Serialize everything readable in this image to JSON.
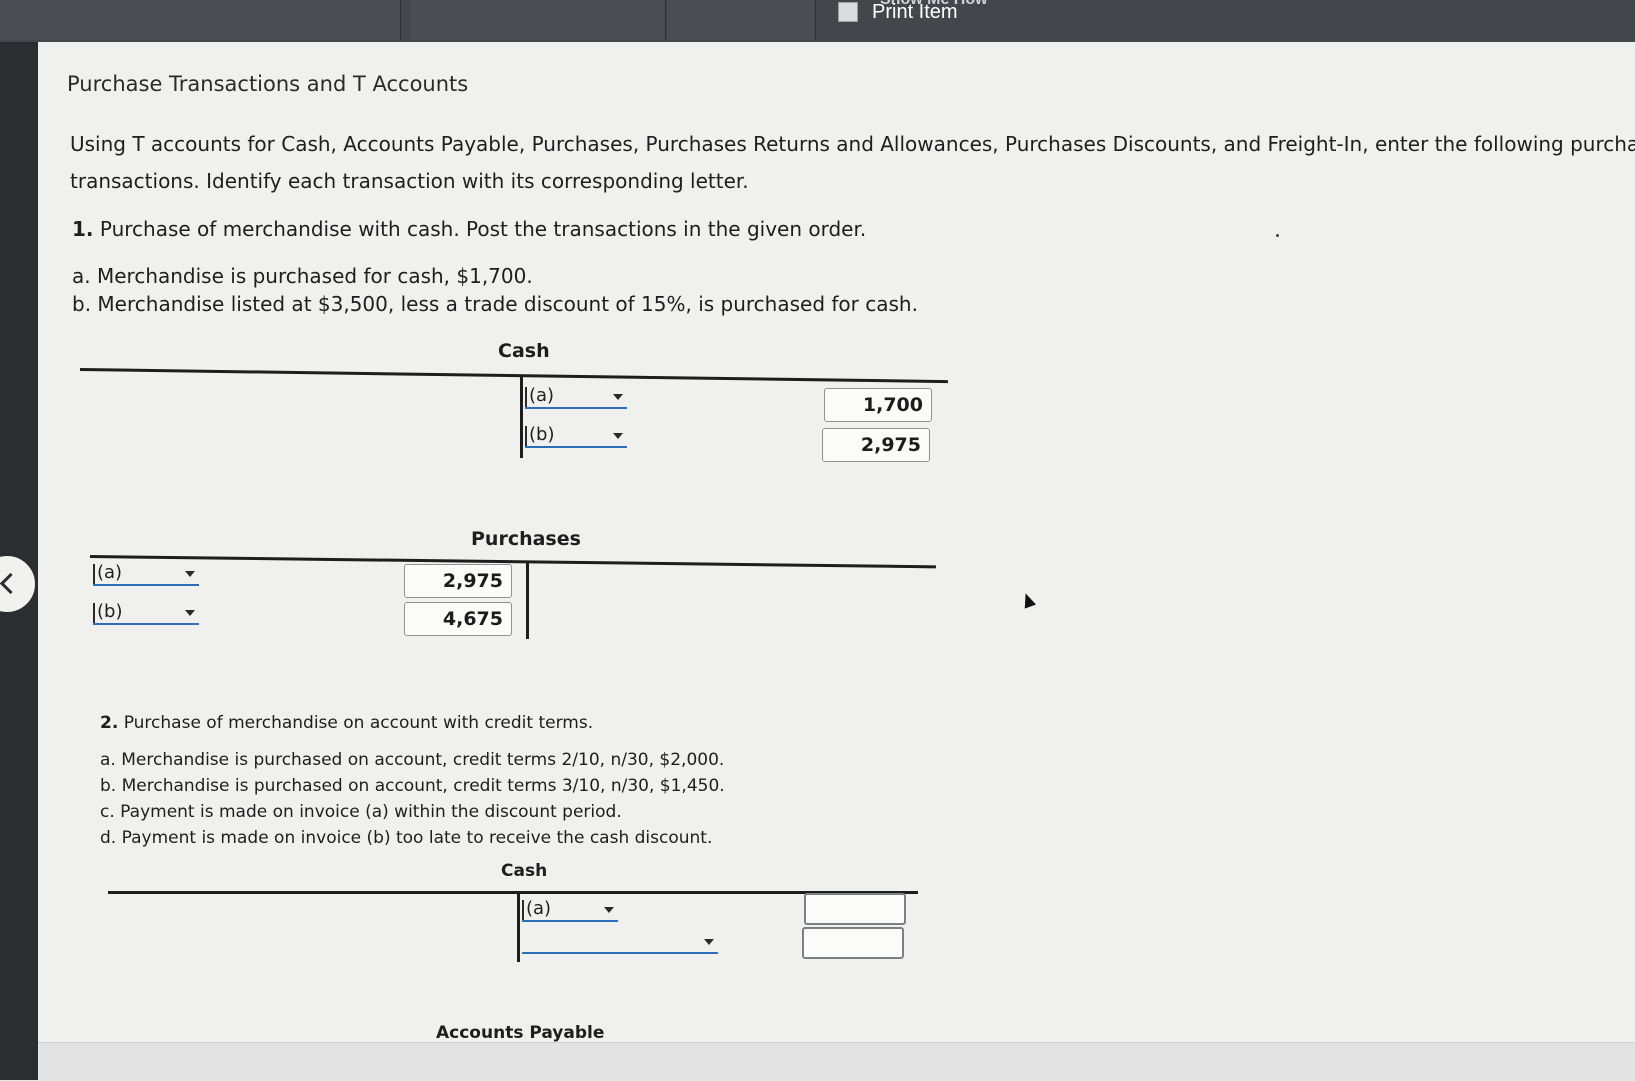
{
  "toolbar": {
    "show_me_how_label": "Show Me How",
    "print_label": "Print Item"
  },
  "page": {
    "title": "Purchase Transactions and T Accounts",
    "intro_line1": "Using T accounts for Cash, Accounts Payable, Purchases, Purchases Returns and Allowances, Purchases Discounts, and Freight-In, enter the following purchase",
    "intro_line2": "transactions. Identify each transaction with its corresponding letter."
  },
  "q1": {
    "number": "1.",
    "text": "Purchase of merchandise with cash. Post the transactions in the given order.",
    "items": [
      {
        "letter": "a.",
        "text": "Merchandise is purchased for cash, $1,700."
      },
      {
        "letter": "b.",
        "text": "Merchandise listed at $3,500, less a trade discount of 15%, is purchased for cash."
      }
    ],
    "cash_account": {
      "title": "Cash",
      "credit_entries": [
        {
          "label": "(a)",
          "amount": "1,700"
        },
        {
          "label": "(b)",
          "amount": "2,975"
        }
      ]
    },
    "purchases_account": {
      "title": "Purchases",
      "debit_entries": [
        {
          "label": "(a)",
          "amount": "2,975"
        },
        {
          "label": "(b)",
          "amount": "4,675"
        }
      ]
    }
  },
  "q2": {
    "number": "2.",
    "text": "Purchase of merchandise on account with credit terms.",
    "items": [
      {
        "letter": "a.",
        "text": "Merchandise is purchased on account, credit terms 2/10, n/30, $2,000."
      },
      {
        "letter": "b.",
        "text": "Merchandise is purchased on account, credit terms 3/10, n/30, $1,450."
      },
      {
        "letter": "c.",
        "text": "Payment is made on invoice (a) within the discount period."
      },
      {
        "letter": "d.",
        "text": "Payment is made on invoice (b) too late to receive the cash discount."
      }
    ],
    "cash_account": {
      "title": "Cash",
      "credit_entries": [
        {
          "label": "(a)",
          "amount": ""
        },
        {
          "label": "",
          "amount": ""
        }
      ]
    },
    "accounts_payable_title": "Accounts Payable"
  }
}
